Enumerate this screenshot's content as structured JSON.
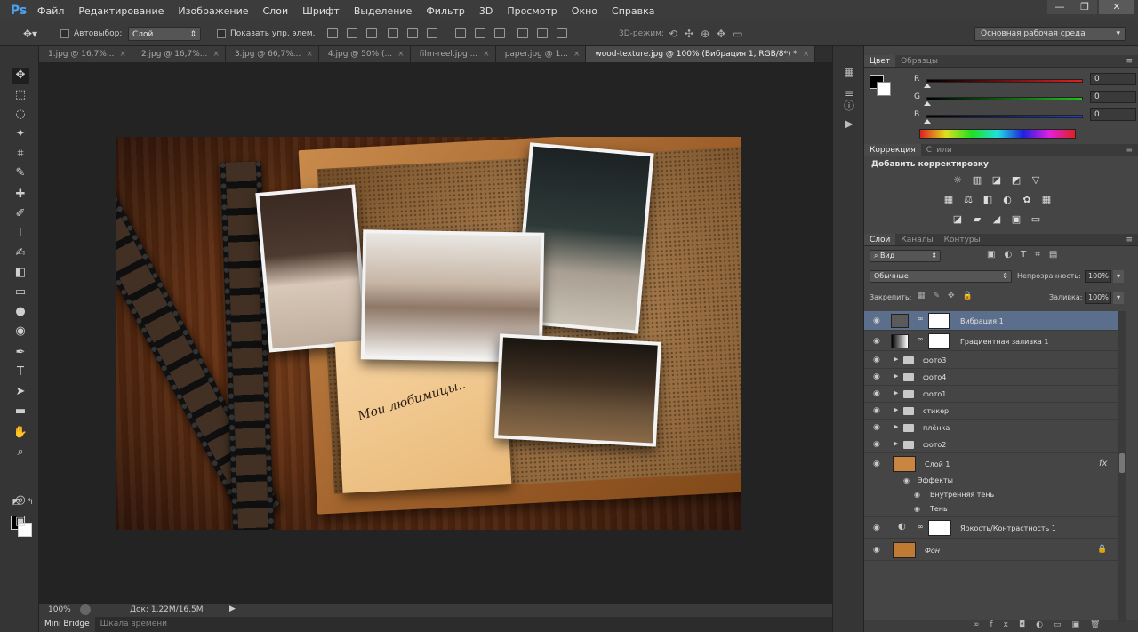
{
  "app": {
    "logo": "Ps"
  },
  "menu": [
    "Файл",
    "Редактирование",
    "Изображение",
    "Слои",
    "Шрифт",
    "Выделение",
    "Фильтр",
    "3D",
    "Просмотр",
    "Окно",
    "Справка"
  ],
  "window_controls": [
    "—",
    "❐",
    "✕"
  ],
  "options_bar": {
    "auto_select_label": "Автовыбор:",
    "auto_select_value": "Слой",
    "show_controls_label": "Показать упр. элем.",
    "mode_3d_label": "3D-режим:",
    "workspace": "Основная рабочая среда"
  },
  "doc_tabs": [
    {
      "label": "1.jpg @ 16,7%...",
      "active": false
    },
    {
      "label": "2.jpg @ 16,7%...",
      "active": false
    },
    {
      "label": "3.jpg @ 66,7%...",
      "active": false
    },
    {
      "label": "4.jpg @ 50% (...",
      "active": false
    },
    {
      "label": "film-reel.jpg ...",
      "active": false
    },
    {
      "label": "paper.jpg @ 1...",
      "active": false
    },
    {
      "label": "wood-texture.jpg @ 100% (Вибрация 1, RGB/8*) *",
      "active": true
    }
  ],
  "canvas": {
    "note_text": "Мои любимицы.."
  },
  "status": {
    "zoom": "100%",
    "doc": "Док: 1,22M/16,5M"
  },
  "bottom_tabs": [
    "Mini Bridge",
    "Шкала времени"
  ],
  "color_panel": {
    "tabs": [
      "Цвет",
      "Образцы"
    ],
    "channels": [
      {
        "label": "R",
        "value": "0",
        "color": "#e02020"
      },
      {
        "label": "G",
        "value": "0",
        "color": "#20c020"
      },
      {
        "label": "B",
        "value": "0",
        "color": "#2040e0"
      }
    ]
  },
  "adjust_panel": {
    "tabs": [
      "Коррекция",
      "Стили"
    ],
    "title": "Добавить корректировку"
  },
  "layers_panel": {
    "tabs": [
      "Слои",
      "Каналы",
      "Контуры"
    ],
    "filter_kind": "Вид",
    "blend_mode": "Обычные",
    "opacity_label": "Непрозрачность:",
    "opacity_value": "100%",
    "lock_label": "Закрепить:",
    "fill_label": "Заливка:",
    "fill_value": "100%",
    "layers": [
      {
        "name": "Вибрация 1",
        "kind": "adjustment",
        "selected": true
      },
      {
        "name": "Градиентная заливка 1",
        "kind": "gradient",
        "selected": false
      },
      {
        "name": "фото3",
        "kind": "group"
      },
      {
        "name": "фото4",
        "kind": "group"
      },
      {
        "name": "фото1",
        "kind": "group"
      },
      {
        "name": "стикер",
        "kind": "group"
      },
      {
        "name": "плёнка",
        "kind": "group"
      },
      {
        "name": "фото2",
        "kind": "group"
      },
      {
        "name": "Слой 1",
        "kind": "pixel",
        "fx": "fx"
      },
      {
        "name": "Эффекты",
        "kind": "effects-header"
      },
      {
        "name": "Внутренняя тень",
        "kind": "effect"
      },
      {
        "name": "Тень",
        "kind": "effect"
      },
      {
        "name": "Яркость/Контрастность 1",
        "kind": "adjustment"
      },
      {
        "name": "Фон",
        "kind": "background"
      }
    ]
  }
}
